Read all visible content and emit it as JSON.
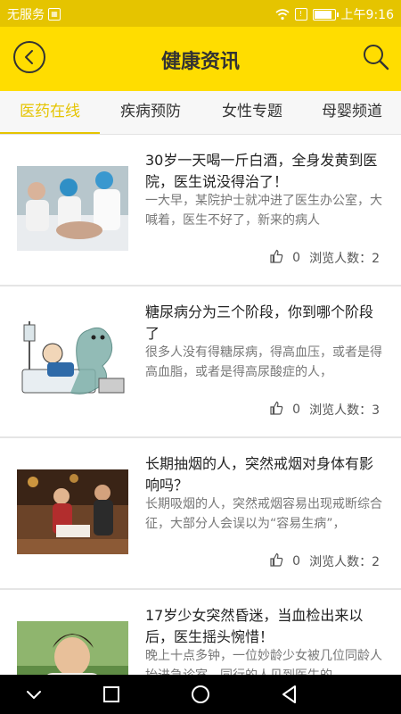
{
  "status_bar": {
    "carrier": "无服务",
    "time": "上午9:16",
    "battery_level": 0.8
  },
  "header": {
    "title": "健康资讯"
  },
  "tabs": [
    {
      "label": "医药在线",
      "active": true
    },
    {
      "label": "疾病预防",
      "active": false
    },
    {
      "label": "女性专题",
      "active": false
    },
    {
      "label": "母婴频道",
      "active": false
    }
  ],
  "articles": [
    {
      "title": "30岁一天喝一斤白酒，全身发黄到医院，医生说没得治了！",
      "summary": "一大早，某院护士就冲进了医生办公室，大喊着，医生不好了，新来的病人",
      "likes": "0",
      "views_label": "浏览人数：2"
    },
    {
      "title": "糖尿病分为三个阶段，你到哪个阶段了",
      "summary": "很多人没有得糖尿病，得高血压，或者是得高血脂，或者是得高尿酸症的人，",
      "likes": "0",
      "views_label": "浏览人数：3"
    },
    {
      "title": "长期抽烟的人，突然戒烟对身体有影响吗？",
      "summary": "长期吸烟的人，突然戒烟容易出现戒断综合征，大部分人会误以为“容易生病”，",
      "likes": "0",
      "views_label": "浏览人数：2"
    },
    {
      "title": "17岁少女突然昏迷，当血检出来以后，医生摇头惋惜！",
      "summary": "晚上十点多钟，一位妙龄少女被几位同龄人抬进急诊室，同行的人见到医生的",
      "likes": "",
      "views_label": ""
    }
  ],
  "colors": {
    "status_bar": "#e5c400",
    "header": "#ffdd00",
    "active_tab": "#e5c400"
  },
  "icons": {
    "back": "back-circle-icon",
    "search": "search-icon",
    "like": "thumbs-up-icon",
    "nav": [
      "nav-back-chevron-icon",
      "nav-recents-square-icon",
      "nav-home-circle-icon",
      "nav-back-triangle-icon"
    ]
  }
}
